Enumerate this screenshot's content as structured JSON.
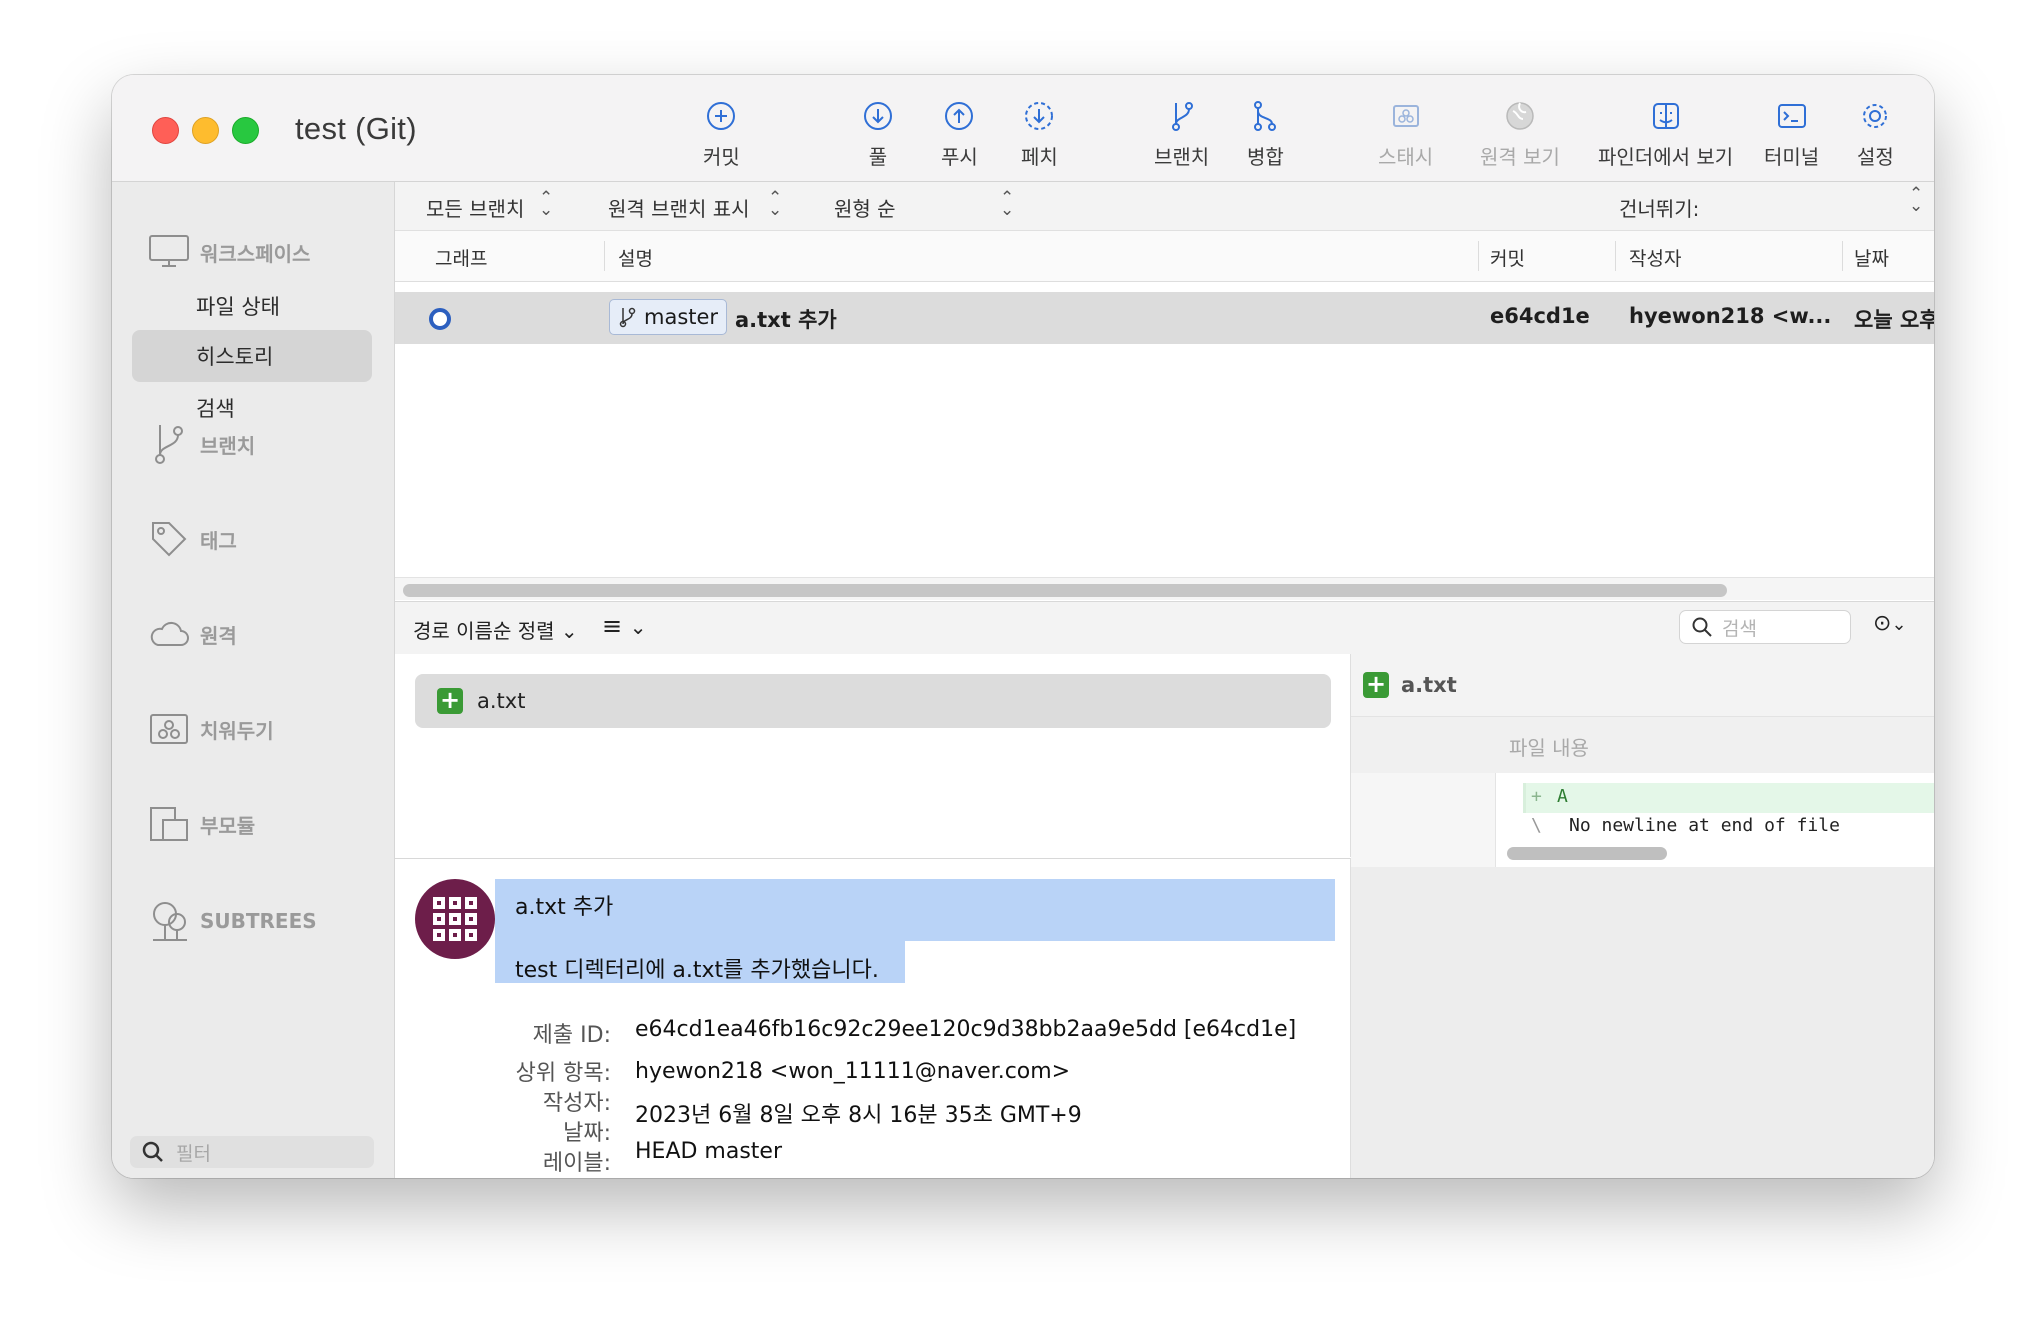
{
  "window": {
    "title": "test (Git)"
  },
  "toolbar": {
    "commit": "커밋",
    "pull": "풀",
    "push": "푸시",
    "fetch": "페치",
    "branch": "브랜치",
    "merge": "병합",
    "stash": "스태시",
    "remote_view": "원격 보기",
    "finder": "파인더에서 보기",
    "terminal": "터미널",
    "settings": "설정"
  },
  "sidebar": {
    "workspace": "워크스페이스",
    "items": [
      "파일 상태",
      "히스토리",
      "검색"
    ],
    "active_item": "히스토리",
    "sections": [
      "브랜치",
      "태그",
      "원격",
      "치워두기",
      "부모듈",
      "SUBTREES"
    ],
    "filter_placeholder": "필터"
  },
  "filters": {
    "branches": "모든 브랜치",
    "remote": "원격 브랜치 표시",
    "order": "원형 순",
    "skip": "건너뛰기:"
  },
  "columns": {
    "graph": "그래프",
    "description": "설명",
    "commit": "커밋",
    "author": "작성자",
    "date": "날짜"
  },
  "commits": [
    {
      "branch": "master",
      "message": "a.txt 추가",
      "hash": "e64cd1e",
      "author": "hyewon218 <w...",
      "date": "오늘 오후"
    }
  ],
  "files_bar": {
    "sort": "경로 이름순 정렬",
    "search_placeholder": "검색"
  },
  "files": [
    {
      "name": "a.txt",
      "status": "added"
    }
  ],
  "details": {
    "summary": "a.txt 추가",
    "body": "test 디렉터리에 a.txt를 추가했습니다.",
    "keys": {
      "id": "제출 ID:",
      "parent": "상위 항목:",
      "author": "작성자:",
      "date": "날짜:",
      "labels": "레이블:"
    },
    "id": "e64cd1ea46fb16c92c29ee120c9d38bb2aa9e5dd [e64cd1e]",
    "author": "hyewon218 <won_11111@naver.com>",
    "date": "2023년 6월 8일 오후 8시 16분 35초 GMT+9",
    "labels": "HEAD master"
  },
  "diff": {
    "file": "a.txt",
    "hunk_header": "파일 내용",
    "lines": [
      {
        "sign": "+",
        "text": "A"
      },
      {
        "sign": "\\",
        "text": "No newline at end of file"
      }
    ]
  },
  "colors": {
    "added": "#3a9a35",
    "selection": "#b9d3f7",
    "graph_node": "#2c5fbf",
    "close": "#ff5f57",
    "minimize": "#febc2e",
    "zoom": "#28c840"
  }
}
